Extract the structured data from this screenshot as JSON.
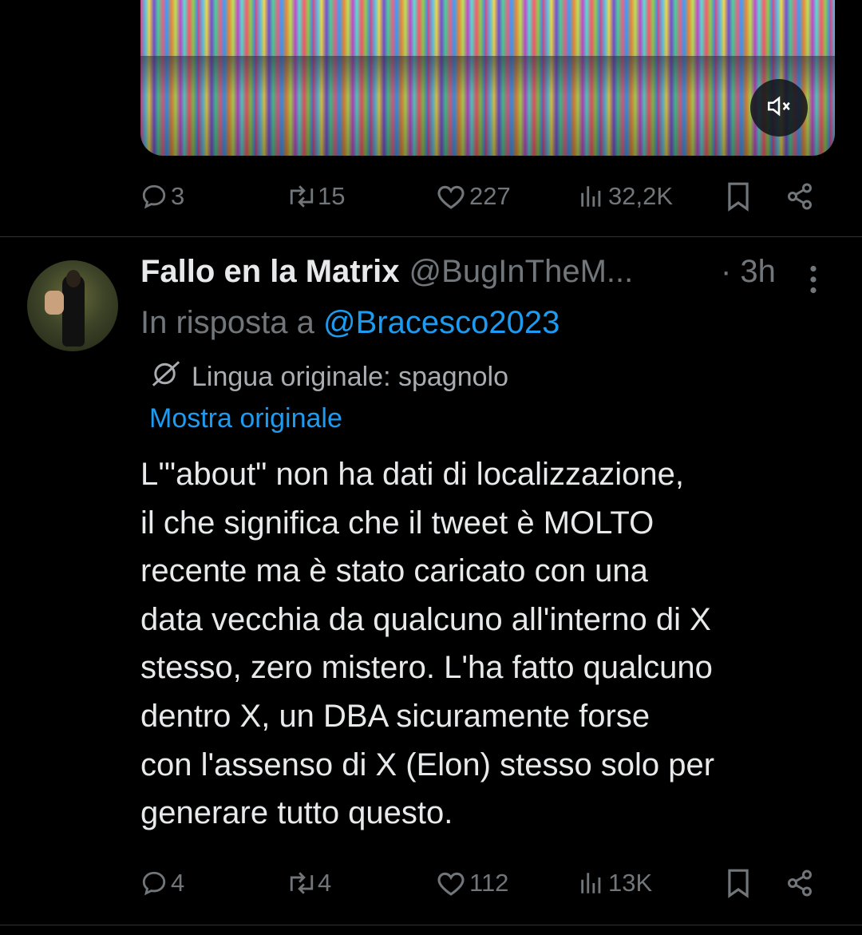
{
  "tweet1": {
    "actions": {
      "replies": "3",
      "reposts": "15",
      "likes": "227",
      "views": "32,2K"
    }
  },
  "tweet2": {
    "author_name": "Fallo en la Matrix",
    "handle": "@BugInTheM...",
    "time": "· 3h",
    "reply_prefix": "In risposta a",
    "reply_to": "@Bracesco2023",
    "original_language": "Lingua originale: spagnolo",
    "show_original": "Mostra originale",
    "body_lines": [
      "L'\"about\" non ha dati di localizzazione,",
      "il che significa che il tweet è MOLTO",
      "recente ma è stato caricato con una",
      "data vecchia da qualcuno all'interno di X",
      "stesso, zero mistero. L'ha fatto qualcuno",
      "dentro X, un DBA sicuramente forse",
      "con l'assenso di X (Elon) stesso solo per",
      "generare tutto questo."
    ],
    "actions": {
      "replies": "4",
      "reposts": "4",
      "likes": "112",
      "views": "13K"
    }
  },
  "icons": {
    "mute": "speaker-muted-icon",
    "reply": "reply-bubble-icon",
    "repost": "repost-arrows-icon",
    "like": "heart-icon",
    "views": "views-bars-icon",
    "bookmark": "bookmark-icon",
    "share": "share-icon",
    "more": "more-vertical-icon",
    "translate": "translate-icon"
  },
  "colors": {
    "background": "#000000",
    "text": "#e7e9ea",
    "muted": "#71767b",
    "accent": "#1d9bf0"
  }
}
